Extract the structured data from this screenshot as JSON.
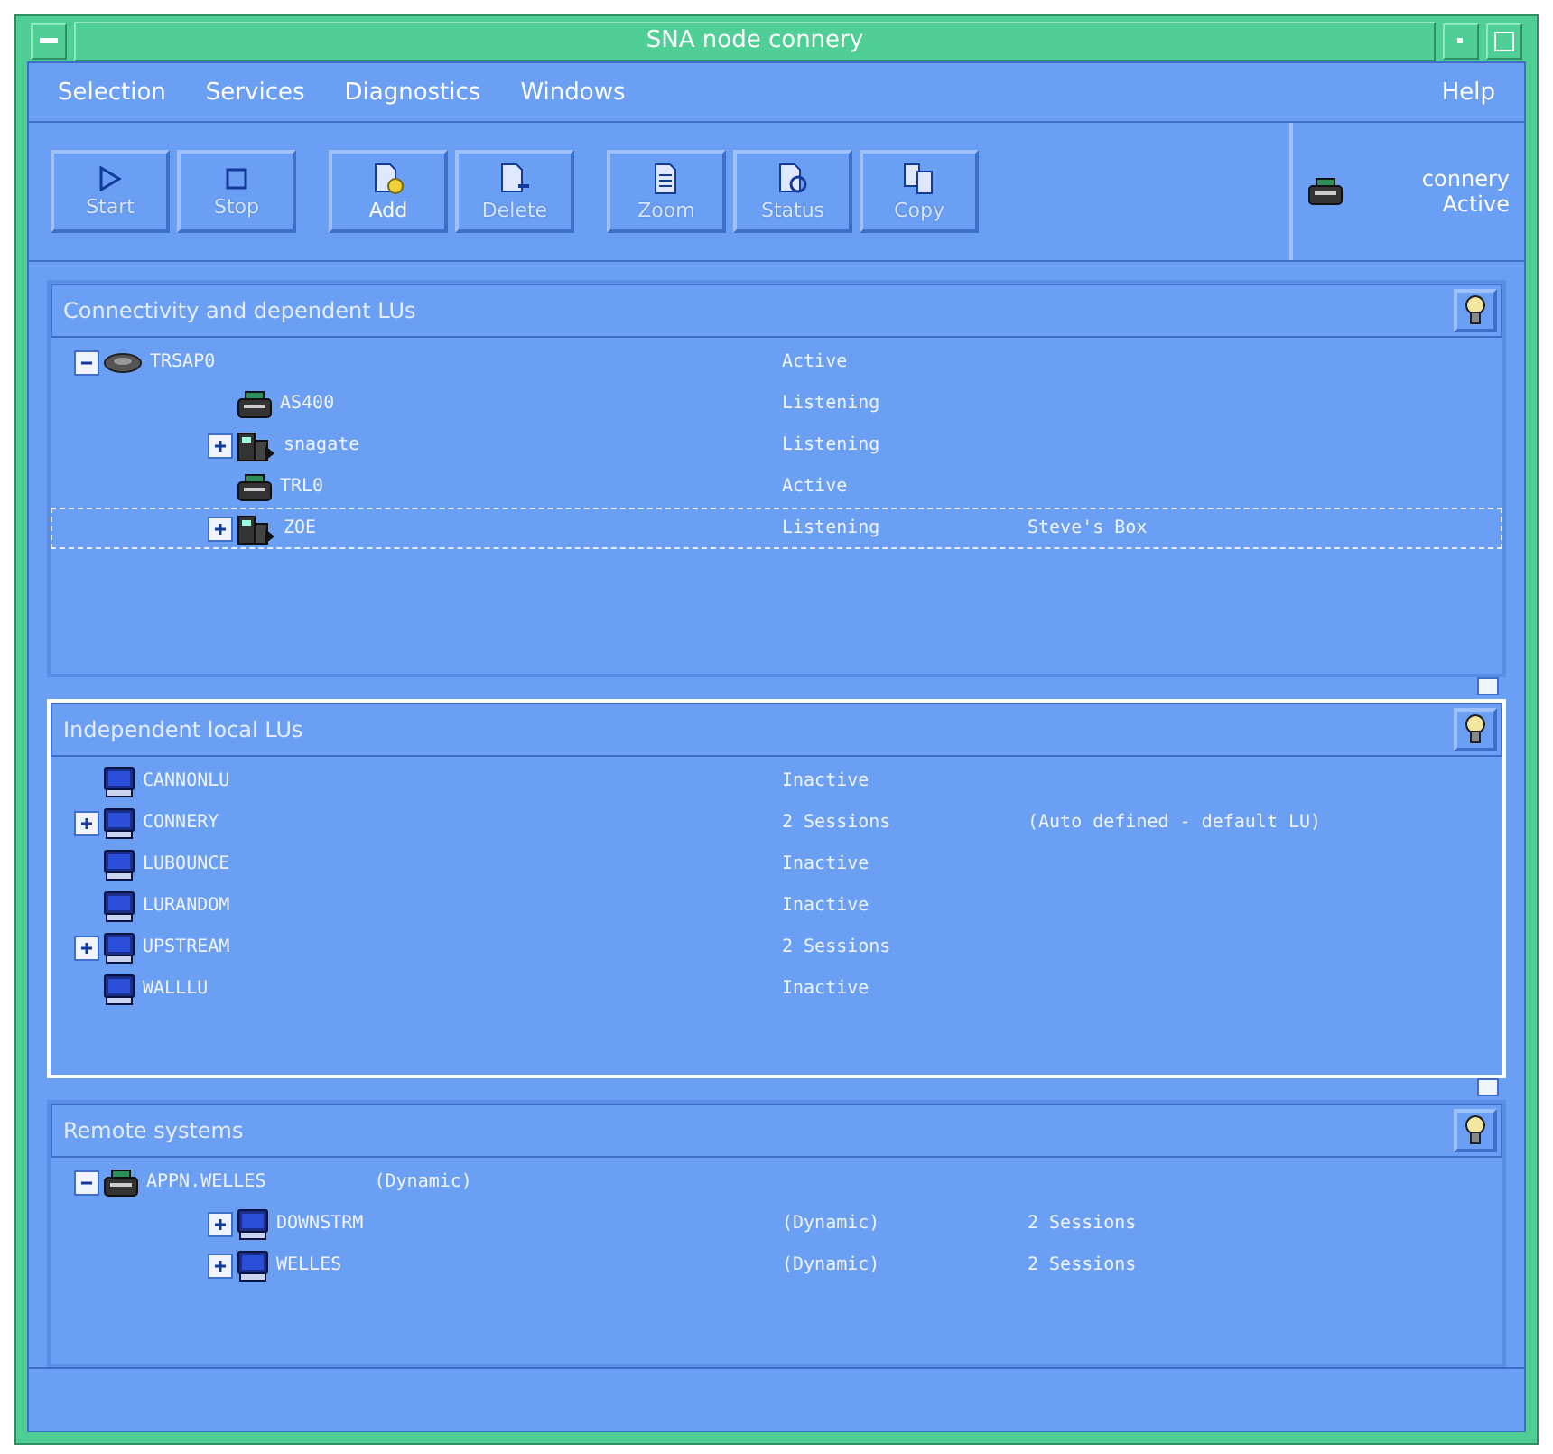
{
  "window": {
    "title": "SNA node connery"
  },
  "menu": [
    {
      "label": "Selection"
    },
    {
      "label": "Services"
    },
    {
      "label": "Diagnostics"
    },
    {
      "label": "Windows"
    },
    {
      "label": "Help"
    }
  ],
  "toolbar": [
    {
      "label": "Start",
      "kind": "play",
      "disabled": true
    },
    {
      "label": "Stop",
      "kind": "stop",
      "disabled": true
    },
    {
      "label": "Add",
      "kind": "add",
      "disabled": false
    },
    {
      "label": "Delete",
      "kind": "delete",
      "disabled": true
    },
    {
      "label": "Zoom",
      "kind": "doc",
      "disabled": true
    },
    {
      "label": "Status",
      "kind": "status",
      "disabled": true
    },
    {
      "label": "Copy",
      "kind": "copy",
      "disabled": true
    }
  ],
  "node_status": {
    "name": "connery",
    "state": "Active"
  },
  "panels": [
    {
      "title": "Connectivity and dependent LUs",
      "selected": false,
      "rows": [
        {
          "name": "TRSAP0",
          "kind": "network",
          "expanded": true,
          "focused": false,
          "status": "Active",
          "children": [
            {
              "name": "AS400",
              "kind": "host",
              "focused": false,
              "status": "Listening"
            },
            {
              "name": "snagate",
              "kind": "gateway",
              "expanded": false,
              "focused": false,
              "status": "Listening"
            },
            {
              "name": "TRL0",
              "kind": "host",
              "focused": false,
              "status": "Active"
            },
            {
              "name": "ZOE",
              "kind": "gateway",
              "expanded": false,
              "focused": true,
              "status": "Listening",
              "note": "Steve's Box"
            }
          ]
        }
      ]
    },
    {
      "title": "Independent local LUs",
      "selected": true,
      "rows": [
        {
          "name": "CANNONLU",
          "kind": "terminal",
          "focused": false,
          "status": "Inactive"
        },
        {
          "name": "CONNERY",
          "kind": "terminal",
          "expanded": false,
          "focused": false,
          "status": "2 Sessions",
          "note": "(Auto defined - default LU)"
        },
        {
          "name": "LUBOUNCE",
          "kind": "terminal",
          "focused": false,
          "status": "Inactive"
        },
        {
          "name": "LURANDOM",
          "kind": "terminal",
          "focused": false,
          "status": "Inactive"
        },
        {
          "name": "UPSTREAM",
          "kind": "terminal",
          "expanded": false,
          "focused": false,
          "status": "2 Sessions"
        },
        {
          "name": "WALLLU",
          "kind": "terminal",
          "focused": false,
          "status": "Inactive"
        }
      ]
    },
    {
      "title": "Remote systems",
      "selected": false,
      "rows": [
        {
          "name": "APPN.WELLES",
          "kind": "host",
          "expanded": true,
          "focused": false,
          "tag": "(Dynamic)",
          "children": [
            {
              "name": "DOWNSTRM",
              "kind": "terminal",
              "expanded": false,
              "focused": false,
              "status": "(Dynamic)",
              "note": "2 Sessions"
            },
            {
              "name": "WELLES",
              "kind": "terminal",
              "expanded": false,
              "focused": false,
              "status": "(Dynamic)",
              "note": "2 Sessions"
            }
          ]
        }
      ]
    }
  ]
}
